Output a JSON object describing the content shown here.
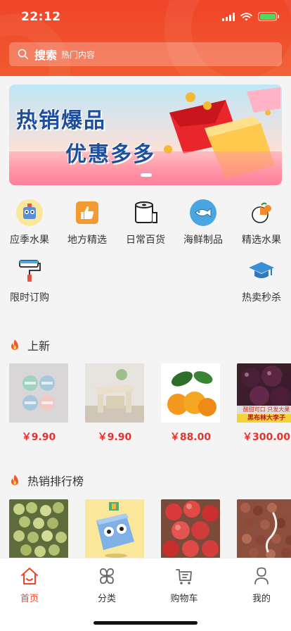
{
  "status": {
    "time": "22:12"
  },
  "search": {
    "label": "搜索",
    "placeholder": "热门内容"
  },
  "banner": {
    "title_line1": "热销爆品",
    "title_line2": "优惠多多"
  },
  "categories": [
    {
      "label": "应季水果",
      "icon": "robot-icon"
    },
    {
      "label": "地方精选",
      "icon": "thumbs-up-icon"
    },
    {
      "label": "日常百货",
      "icon": "toilet-paper-icon"
    },
    {
      "label": "海鲜制品",
      "icon": "fish-icon"
    },
    {
      "label": "精选水果",
      "icon": "orange-icon"
    },
    {
      "label": "限时订购",
      "icon": "paint-roller-icon"
    },
    {
      "label": "热卖秒杀",
      "icon": "graduation-cap-icon"
    }
  ],
  "sections": {
    "new": {
      "title": "上新",
      "products": [
        {
          "price": "￥9.90",
          "image": "wall-hooks"
        },
        {
          "price": "￥9.90",
          "image": "folding-stool"
        },
        {
          "price": "￥88.00",
          "image": "oranges"
        },
        {
          "price": "￥300.00",
          "image": "plums",
          "caption_1": "酸甜可口 只发大果",
          "caption_2": "黑布林大李子"
        }
      ]
    },
    "hot": {
      "title": "热销排行榜",
      "products": [
        {
          "image": "grapes"
        },
        {
          "image": "robot-box"
        },
        {
          "image": "apples"
        },
        {
          "image": "dried-fruit"
        }
      ]
    }
  },
  "tabbar": [
    {
      "label": "首页",
      "icon": "home-icon",
      "active": true
    },
    {
      "label": "分类",
      "icon": "category-icon",
      "active": false
    },
    {
      "label": "购物车",
      "icon": "cart-icon",
      "active": false
    },
    {
      "label": "我的",
      "icon": "user-icon",
      "active": false
    }
  ],
  "colors": {
    "brand": "#f0452a",
    "price": "#e5322d"
  }
}
